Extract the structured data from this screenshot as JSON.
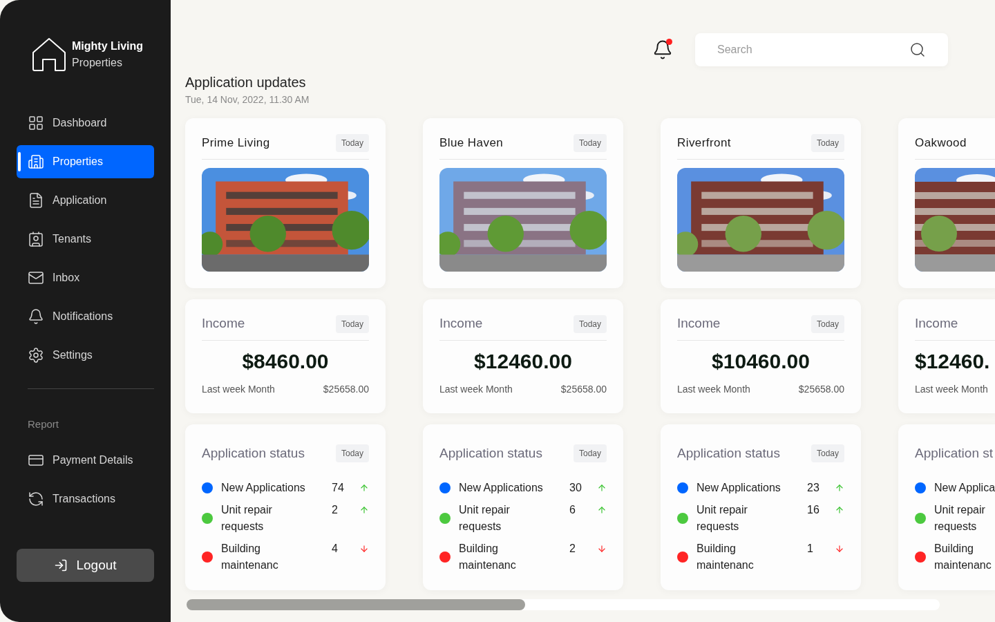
{
  "brand": {
    "name": "Mighty Living",
    "subtitle": "Properties"
  },
  "nav": [
    {
      "label": "Dashboard",
      "selected": false
    },
    {
      "label": "Properties",
      "selected": true
    },
    {
      "label": "Application",
      "selected": false
    },
    {
      "label": "Tenants",
      "selected": false
    },
    {
      "label": "Inbox",
      "selected": false
    },
    {
      "label": "Notifications",
      "selected": false
    },
    {
      "label": "Settings",
      "selected": false
    }
  ],
  "report_heading": "Report",
  "report_nav": [
    {
      "label": "Payment Details",
      "selected": false
    },
    {
      "label": "Transactions",
      "selected": false
    }
  ],
  "logout": "Logout",
  "notifications": {
    "unread": true
  },
  "search": {
    "placeholder": "Search"
  },
  "page": {
    "title": "Application updates",
    "date": "Tue, 14 Nov, 2022, 11.30 AM"
  },
  "properties": [
    {
      "name": "Prime Living",
      "badge": "Today",
      "income": {
        "title": "Income",
        "badge": "Today",
        "amount": "$8460.00",
        "footer_label": "Last week Month",
        "footer_value": "$25658.00"
      },
      "status": {
        "title": "Application status",
        "badge": "Today",
        "rows": [
          {
            "label": "New Applications",
            "count": "74",
            "rising": true,
            "color": "#0066ff"
          },
          {
            "label": "Unit repair requests",
            "count": "2",
            "rising": true,
            "color": "#4cc93f"
          },
          {
            "label": "Building maintenanc",
            "count": "4",
            "rising": false,
            "color": "#ff2424"
          }
        ]
      }
    },
    {
      "name": "Blue Haven",
      "badge": "Today",
      "income": {
        "title": "Income",
        "badge": "Today",
        "amount": "$12460.00",
        "footer_label": "Last week Month",
        "footer_value": "$25658.00"
      },
      "status": {
        "title": "Application status",
        "badge": "Today",
        "rows": [
          {
            "label": "New Applications",
            "count": "30",
            "rising": true,
            "color": "#0066ff"
          },
          {
            "label": "Unit repair requests",
            "count": "6",
            "rising": true,
            "color": "#4cc93f"
          },
          {
            "label": "Building maintenanc",
            "count": "2",
            "rising": false,
            "color": "#ff2424"
          }
        ]
      }
    },
    {
      "name": "Riverfront",
      "badge": "Today",
      "income": {
        "title": "Income",
        "badge": "Today",
        "amount": "$10460.00",
        "footer_label": "Last week Month",
        "footer_value": "$25658.00"
      },
      "status": {
        "title": "Application status",
        "badge": "Today",
        "rows": [
          {
            "label": "New Applications",
            "count": "23",
            "rising": true,
            "color": "#0066ff"
          },
          {
            "label": "Unit repair requests",
            "count": "16",
            "rising": true,
            "color": "#4cc93f"
          },
          {
            "label": "Building maintenanc",
            "count": "1",
            "rising": false,
            "color": "#ff2424"
          }
        ]
      }
    }
  ],
  "partial_property": {
    "name": "Oakwood",
    "income": {
      "title": "Income",
      "amount": "$12460.",
      "footer_label": "Last week Month"
    },
    "status": {
      "title": "Application st",
      "rows": [
        {
          "label": "New Applica",
          "color": "#0066ff"
        },
        {
          "label": "Unit repair requests",
          "color": "#4cc93f"
        },
        {
          "label": "Building maintenanc",
          "color": "#ff2424"
        }
      ]
    }
  }
}
